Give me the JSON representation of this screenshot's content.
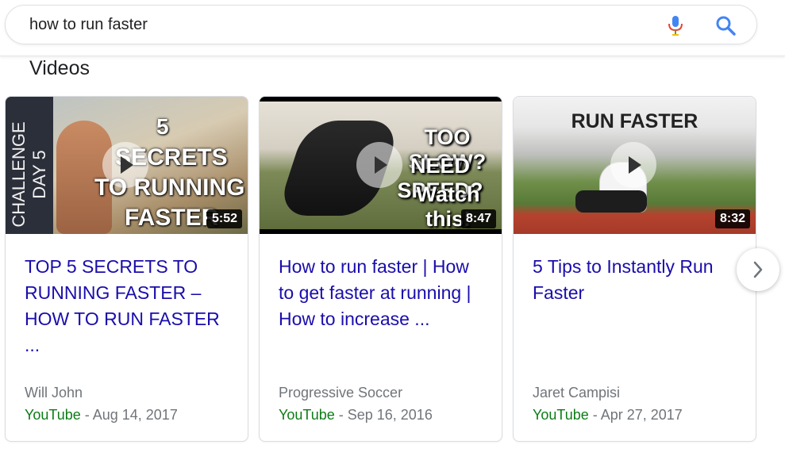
{
  "search": {
    "query": "how to run faster",
    "mic_icon": "microphone-icon",
    "search_icon": "magnifier-icon"
  },
  "section": {
    "title": "Videos"
  },
  "colors": {
    "link": "#1a0dab",
    "source": "#0c7c16",
    "muted": "#70757a"
  },
  "videos": [
    {
      "title": "TOP 5 SECRETS TO RUNNING FASTER – HOW TO RUN FASTER ...",
      "duration": "5:52",
      "author": "Will John",
      "source": "YouTube",
      "date": " - Aug 14, 2017",
      "overlay_side": "CHALLENGE DAY 5",
      "overlay_text": [
        "5",
        "SECRETS",
        "TO RUNNING",
        "FASTER"
      ]
    },
    {
      "title": "How to run faster | How to get faster at running | How to increase ...",
      "duration": "8:47",
      "author": "Progressive Soccer",
      "source": "YouTube",
      "date": " - Sep 16, 2016",
      "overlay_text": [
        "TOO SLOW?",
        "NEED SPEED?",
        "Watch this!"
      ]
    },
    {
      "title": "5 Tips to Instantly Run Faster",
      "duration": "8:32",
      "author": "Jaret Campisi",
      "source": "YouTube",
      "date": " - Apr 27, 2017",
      "overlay_text": [
        "RUN FASTER"
      ]
    }
  ],
  "carousel": {
    "next_icon": "chevron-right-icon"
  }
}
